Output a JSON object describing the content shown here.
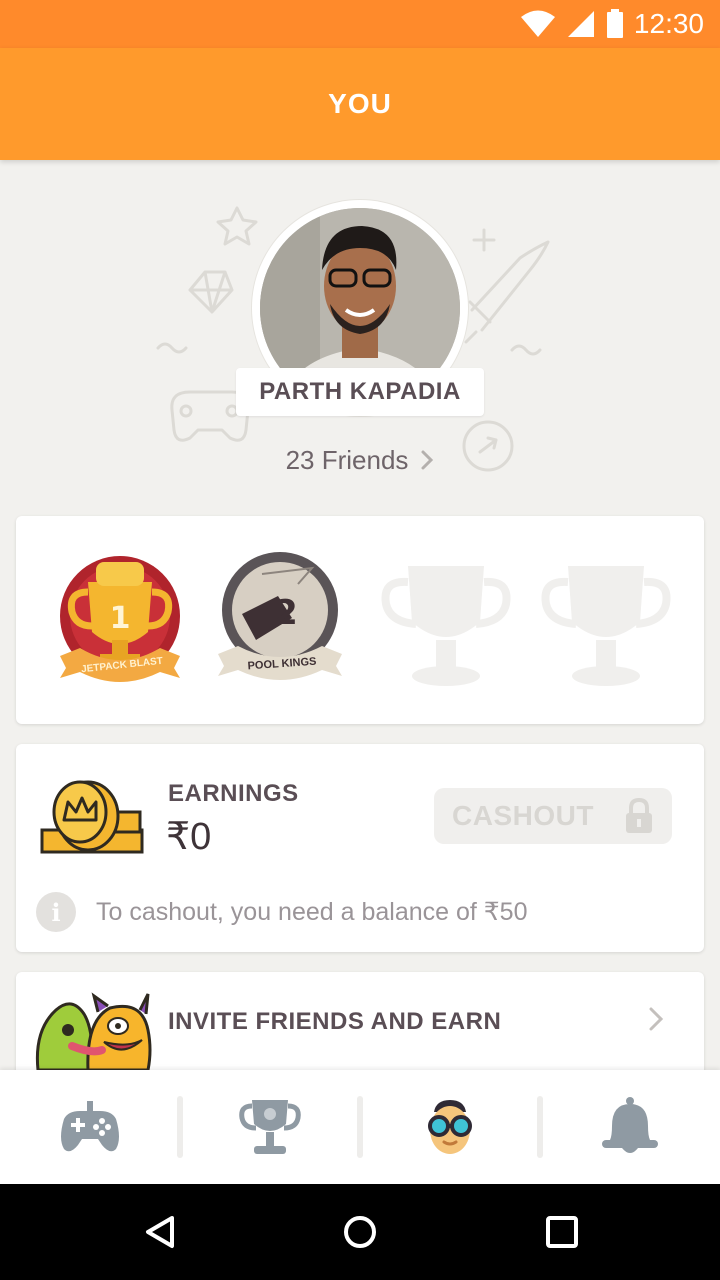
{
  "status_bar": {
    "time": "12:30",
    "icons": [
      "wifi-icon",
      "signal-icon",
      "battery-icon"
    ],
    "color": "#ff8a2b"
  },
  "header": {
    "title": "YOU",
    "color": "#ff9a2c"
  },
  "profile": {
    "name": "PARTH KAPADIA",
    "friends_label": "23 Friends"
  },
  "trophies": [
    {
      "name": "JETPACK BLAST",
      "rank": "1",
      "icon": "gold-trophy-icon"
    },
    {
      "name": "POOL KINGS",
      "rank": "2",
      "icon": "silver-medal-icon"
    },
    {
      "name": "",
      "rank": "",
      "icon": "locked-trophy-icon"
    },
    {
      "name": "",
      "rank": "",
      "icon": "locked-trophy-icon"
    }
  ],
  "earnings": {
    "label": "EARNINGS",
    "value": "₹0",
    "cashout_label": "CASHOUT",
    "info_text": "To cashout, you need a balance of ₹50"
  },
  "invite": {
    "label": "INVITE FRIENDS AND EARN"
  },
  "bottom_nav": [
    {
      "name": "games",
      "icon": "gamepad-icon"
    },
    {
      "name": "leaderboard",
      "icon": "trophy-icon"
    },
    {
      "name": "profile",
      "icon": "avatar-glasses-icon",
      "active": true
    },
    {
      "name": "notifications",
      "icon": "bell-icon"
    }
  ]
}
